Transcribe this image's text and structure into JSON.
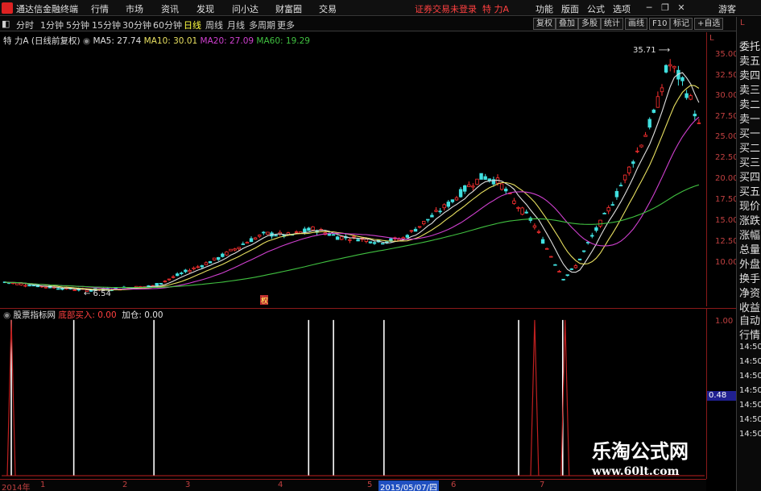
{
  "app": {
    "title": "通达信金融终端",
    "menu": [
      "行情",
      "市场",
      "资讯",
      "发现",
      "问小达",
      "财富圈",
      "交易"
    ],
    "trade_warning": "证券交易未登录",
    "stock_name": "特 力A",
    "right_menu": [
      "功能",
      "版面",
      "公式",
      "选项"
    ],
    "guest": "游客"
  },
  "periods": [
    "分时",
    "1分钟",
    "5分钟",
    "15分钟",
    "30分钟",
    "60分钟",
    "日线",
    "周线",
    "月线",
    "多周期",
    "更多"
  ],
  "active_period": "日线",
  "toolbar": [
    "复权",
    "叠加",
    "多股",
    "统计",
    "画线",
    "F10",
    "标记",
    "+自选"
  ],
  "main": {
    "title": "特 力A",
    "adjust": "(日线前复权)",
    "ma": [
      {
        "label": "MA5: 27.74",
        "color": "#e0e0e0"
      },
      {
        "label": "MA10: 30.01",
        "color": "#e8e060"
      },
      {
        "label": "MA20: 27.09",
        "color": "#d040d0"
      },
      {
        "label": "MA60: 19.29",
        "color": "#40c040"
      }
    ],
    "high_label": "35.71",
    "low_label": "6.54",
    "event_mark": "权",
    "yticks": [
      "35.00",
      "32.50",
      "30.00",
      "27.50",
      "25.00",
      "22.50",
      "20.00",
      "17.50",
      "15.00",
      "12.50",
      "10.00"
    ]
  },
  "sub": {
    "title": "股票指标网",
    "indicator": "底部买入",
    "indicator_value": "0.00",
    "add_label": "加仓",
    "add_value": "0.00",
    "yticks": [
      "1.00",
      "0.48"
    ]
  },
  "side": [
    "委托",
    "卖五",
    "卖四",
    "卖三",
    "卖二",
    "卖一",
    "买一",
    "买二",
    "买三",
    "买四",
    "买五",
    "现价",
    "涨跌",
    "涨幅",
    "总量",
    "外盘",
    "换手",
    "净资",
    "收益",
    "自动",
    "行情"
  ],
  "side_times": [
    "14:50",
    "14:50",
    "14:50",
    "14:50",
    "14:50",
    "14:50",
    "14:50"
  ],
  "xaxis": {
    "labels": [
      "2014年",
      "1",
      "2",
      "3",
      "4",
      "5",
      "6",
      "7"
    ],
    "cursor_date": "2015/05/07/四"
  },
  "watermark": {
    "line1": "乐淘公式网",
    "line2": "www.60lt.com"
  },
  "chart_data": {
    "type": "candlestick",
    "price_range": [
      6.0,
      36.5
    ],
    "ma_labels": [
      "MA5",
      "MA10",
      "MA20",
      "MA60"
    ],
    "signal_bars": [
      1,
      0,
      0,
      0,
      0,
      0,
      0,
      0,
      0,
      0
    ]
  }
}
